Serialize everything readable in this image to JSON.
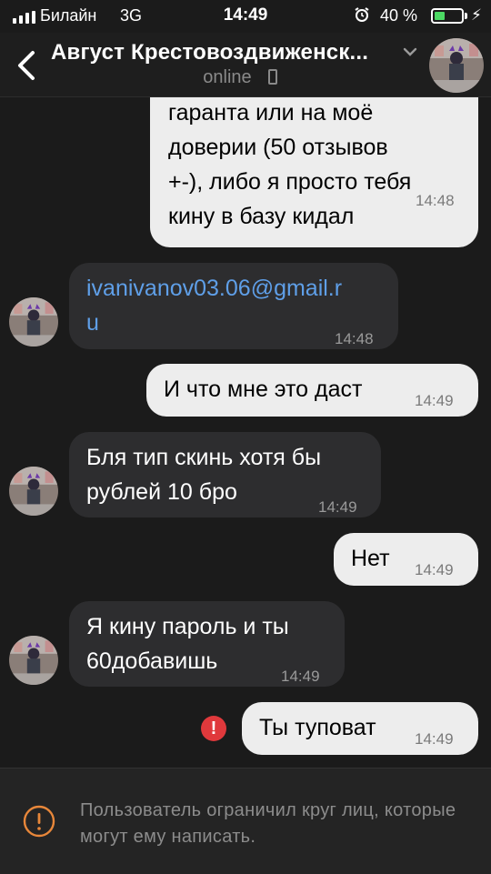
{
  "status_bar": {
    "carrier": "Билайн",
    "network": "3G",
    "time": "14:49",
    "battery_percent": "40 %",
    "battery_level": 0.4,
    "accent_color": "#4cd964"
  },
  "header": {
    "contact_name": "Август Крестовоздвиженск...",
    "status": "online",
    "back_icon": "chevron-left-icon",
    "status_device_icon": "phone-icon"
  },
  "messages": [
    {
      "direction": "out",
      "lines": [
        "гаранта или на моё",
        "доверии (50 отзывов",
        "+-), либо я просто тебя",
        "кину в базу кидал"
      ],
      "time": "14:48"
    },
    {
      "direction": "in",
      "lines": [
        "ivanivanov03.06@gmail.r",
        "u"
      ],
      "time": "14:48",
      "is_link": true
    },
    {
      "direction": "out",
      "lines": [
        "И что мне это даст"
      ],
      "time": "14:49"
    },
    {
      "direction": "in",
      "lines": [
        "Бля тип скинь хотя бы",
        "рублей 10 бро"
      ],
      "time": "14:49"
    },
    {
      "direction": "out",
      "lines": [
        "Нет"
      ],
      "time": "14:49"
    },
    {
      "direction": "in",
      "lines": [
        "Я кину пароль и ты",
        "60добавишь"
      ],
      "time": "14:49"
    },
    {
      "direction": "out",
      "lines": [
        "Ты туповат"
      ],
      "time": "14:49",
      "failed": true
    }
  ],
  "error_mark": "!",
  "footer": {
    "restriction_text": "Пользователь ограничил круг лиц, которые могут ему написать.",
    "icon": "warning-circle-icon"
  },
  "colors": {
    "background": "#1b1b1b",
    "outgoing_bubble": "#ededed",
    "incoming_bubble": "#2d2d2f",
    "link": "#5f9fe8",
    "error": "#e0393c",
    "warning": "#e8873a"
  }
}
